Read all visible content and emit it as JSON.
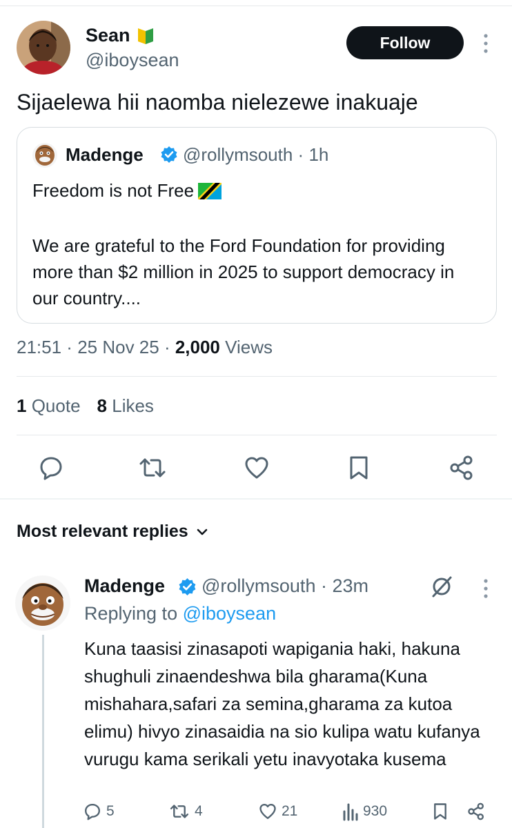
{
  "tweet": {
    "author_name": "Sean",
    "author_handle": "@iboysean",
    "follow_label": "Follow",
    "text": "Sijaelewa hii naomba nielezewe inakuaje",
    "time": "21:51",
    "date": "25 Nov 25",
    "views_count": "2,000",
    "views_label": "Views",
    "quote_count": "1",
    "quote_label": "Quote",
    "likes_count": "8",
    "likes_label": "Likes",
    "badge_icon": "beginner-leaf-icon"
  },
  "quoted": {
    "author_name": "Madenge",
    "author_handle": "@rollymsouth",
    "time_ago": "1h",
    "line1": "Freedom is not Free",
    "flag_icon": "tanzania-flag-icon",
    "body": "We are grateful to the Ford Foundation for providing more than $2 million in 2025 to support democracy in our country...."
  },
  "actions": {
    "icons": [
      "reply-icon",
      "retweet-icon",
      "like-icon",
      "bookmark-icon",
      "share-icon"
    ]
  },
  "replies": {
    "header": "Most relevant replies",
    "items": [
      {
        "author_name": "Madenge",
        "author_handle": "@rollymsouth",
        "time_ago": "23m",
        "replying_prefix": "Replying to",
        "replying_to": "@iboysean",
        "text": "Kuna taasisi zinasapoti wapigania haki, hakuna shughuli zinaendeshwa bila gharama(Kuna mishahara,safari za semina,gharama za kutoa elimu)  hivyo zinasaidia na sio kulipa watu kufanya vurugu kama serikali yetu inavyotaka kusema",
        "reply_count": "5",
        "retweet_count": "4",
        "like_count": "21",
        "view_count": "930"
      }
    ]
  },
  "colors": {
    "text": "#0f1419",
    "secondary": "#536471",
    "accent": "#1d9bf0",
    "border": "#e6e9eb"
  }
}
